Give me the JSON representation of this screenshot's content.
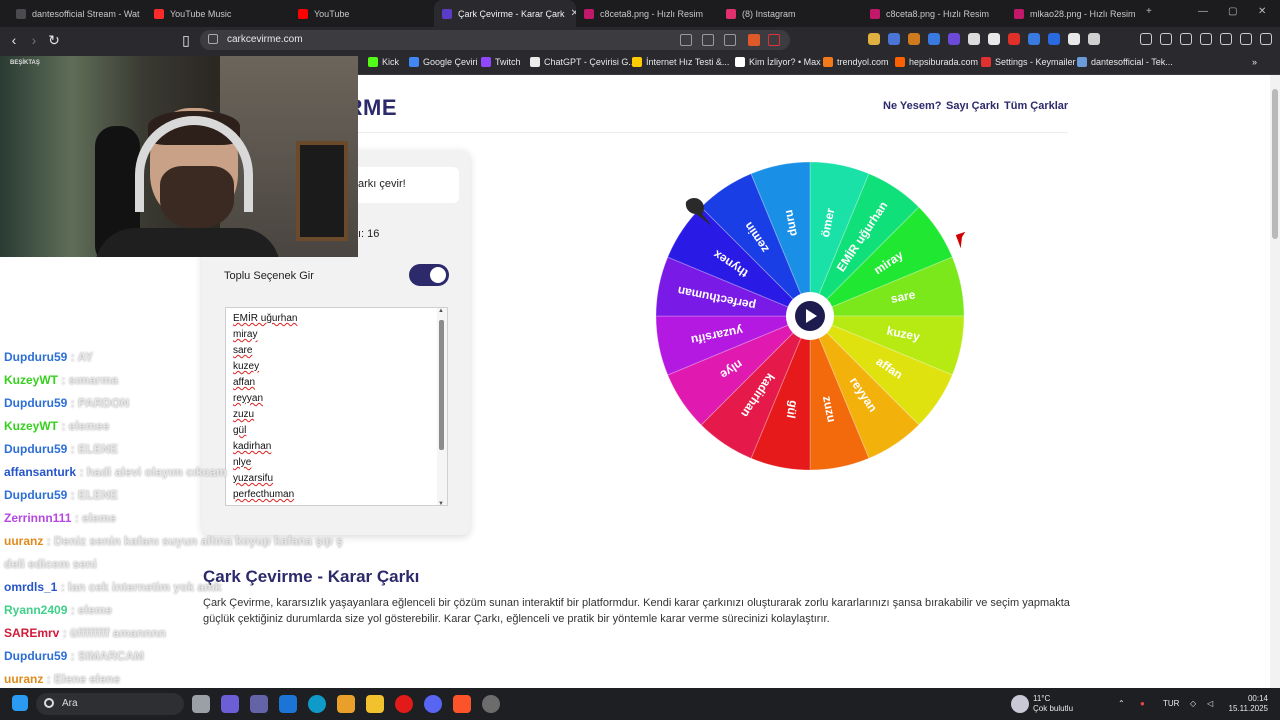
{
  "browser": {
    "tabs": [
      {
        "title": "dantesofficial Stream - Wat",
        "color": "#4a4a4f"
      },
      {
        "title": "YouTube Music",
        "color": "#ff2a2a"
      },
      {
        "title": "YouTube",
        "color": "#ff0000"
      },
      {
        "title": "Çark Çevirme - Karar Çark",
        "color": "#5a3cc8",
        "active": true
      },
      {
        "title": "c8ceta8.png - Hızlı Resim",
        "color": "#c2186a"
      },
      {
        "title": "(8) Instagram",
        "color": "#e1306c"
      },
      {
        "title": "c8ceta8.png - Hızlı Resim",
        "color": "#c2186a"
      },
      {
        "title": "mlkao28.png - Hızlı Resim",
        "color": "#c2186a"
      }
    ],
    "url": "carkcevirme.com",
    "bookmarks": [
      {
        "label": "Kick",
        "color": "#53fc18"
      },
      {
        "label": "Google Çeviri",
        "color": "#4285f4"
      },
      {
        "label": "Twitch",
        "color": "#9146ff"
      },
      {
        "label": "ChatGPT - Çevirisi G...",
        "color": "#ececec"
      },
      {
        "label": "İnternet Hız Testi &...",
        "color": "#ffcc00"
      },
      {
        "label": "Kim İzliyor? • Max",
        "color": "#ffffff"
      },
      {
        "label": "trendyol.com",
        "color": "#f27a1a"
      },
      {
        "label": "hepsiburada.com",
        "color": "#ff6000"
      },
      {
        "label": "Settings - Keymailer",
        "color": "#e03030"
      },
      {
        "label": "dantesofficial - Tek...",
        "color": "#6a9ad8"
      }
    ]
  },
  "site": {
    "logo": "IRME",
    "nav": [
      "Ne Yesem?",
      "Sayı Çarkı",
      "Tüm Çarklar"
    ],
    "instruction": "arkı çevir!",
    "count_label": "ı: 16",
    "toggle_label": "Toplu Seçenek Gir",
    "toggle_on": true,
    "options_visible": [
      "EMİR uğurhan",
      "miray",
      "sare",
      "kuzey",
      "affan",
      "reyyan",
      "zuzu",
      "gül",
      "kadirhan",
      "nlye",
      "yuzarsifu",
      "perfecthuman"
    ],
    "heading": "Çark Çevirme - Karar Çarkı",
    "paragraph": "Çark Çevirme, kararsızlık yaşayanlara eğlenceli bir çözüm sunan interaktif bir platformdur. Kendi karar çarkınızı oluşturarak zorlu kararlarınızı şansa bırakabilir ve seçim yapmakta güçlük çektiğiniz durumlarda size yol gösterebilir. Karar Çarkı, eğlenceli ve pratik bir yöntemle karar verme sürecinizi kolaylaştırır."
  },
  "wheel": {
    "labels": [
      "ömer",
      "EMİR uğurhan",
      "miray",
      "sare",
      "kuzey",
      "affan",
      "reyyan",
      "zuzu",
      "gül",
      "kadirhan",
      "nlye",
      "yuzarsifu",
      "perfecthuman",
      "thynex",
      "zemin",
      "duru"
    ],
    "colors": [
      "#19e1a8",
      "#10e07a",
      "#20e832",
      "#7ae81a",
      "#b7ea13",
      "#dfe20e",
      "#f3b10c",
      "#f36a0c",
      "#e61a1a",
      "#e61a4a",
      "#e019b0",
      "#b319e0",
      "#7a1ae6",
      "#2a1ae6",
      "#1a3ee6",
      "#1a8fe6"
    ]
  },
  "stream_overlay": {
    "cam_banner": "BEŞİKTAŞ",
    "chat": [
      {
        "user": "Dupduru59",
        "text": "AY",
        "color": "#2d6fd6"
      },
      {
        "user": "KuzeyWT",
        "text": "sımarma",
        "color": "#36d11d"
      },
      {
        "user": "Dupduru59",
        "text": "PARDON",
        "color": "#2d6fd6"
      },
      {
        "user": "KuzeyWT",
        "text": "elemee",
        "color": "#36d11d"
      },
      {
        "user": "Dupduru59",
        "text": "ELENE",
        "color": "#2d6fd6"
      },
      {
        "user": "affansanturk",
        "text": "hadi alevi olayım cıkcam",
        "color": "#2555c9"
      },
      {
        "user": "Dupduru59",
        "text": "ELENE",
        "color": "#2d6fd6"
      },
      {
        "user": "Zerrinnn111",
        "text": "eleme",
        "color": "#b548e0"
      },
      {
        "user": "uuranz",
        "text": "Deniz senin kafanı suyun altına koyup kafana şıp ş",
        "color": "#e08a1c"
      },
      {
        "user": "",
        "text": "deli edicem seni",
        "color": "#e08a1c"
      },
      {
        "user": "omrdls_1",
        "text": "lan cek internetim yok amk",
        "color": "#2555c9"
      },
      {
        "user": "Ryann2409",
        "text": "eleme",
        "color": "#3fd08a"
      },
      {
        "user": "SAREmrv",
        "text": "üffffffff amannnn",
        "color": "#d21a3a"
      },
      {
        "user": "Dupduru59",
        "text": "SIMARCAM",
        "color": "#2d6fd6"
      },
      {
        "user": "uuranz",
        "text": "Elene elene",
        "color": "#e08a1c"
      }
    ]
  },
  "taskbar": {
    "search": "Ara",
    "weather_temp": "11°C",
    "weather_text": "Çok bulutlu",
    "lang": "TUR",
    "time": "00:14",
    "date": "15.11.2025"
  }
}
